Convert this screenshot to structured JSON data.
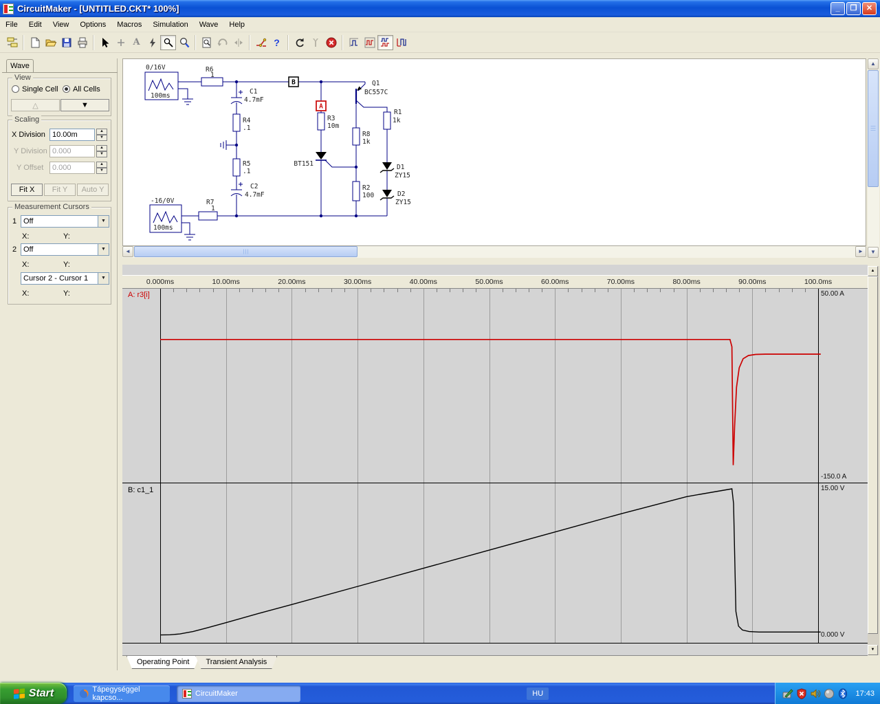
{
  "window": {
    "title": "CircuitMaker - [UNTITLED.CKT* 100%]"
  },
  "menu": {
    "items": [
      "File",
      "Edit",
      "View",
      "Options",
      "Macros",
      "Simulation",
      "Wave",
      "Help"
    ]
  },
  "wave_panel": {
    "tab_label": "Wave",
    "view": {
      "caption": "View",
      "single_cell": "Single Cell",
      "all_cells": "All Cells"
    },
    "scaling": {
      "caption": "Scaling",
      "x_division_label": "X Division",
      "x_division_value": "10.00m",
      "y_division_label": "Y Division",
      "y_division_value": "0.000",
      "y_offset_label": "Y Offset",
      "y_offset_value": "0.000",
      "fit_x": "Fit X",
      "fit_y": "Fit Y",
      "auto_y": "Auto Y"
    },
    "cursors": {
      "caption": "Measurement Cursors",
      "row1_num": "1",
      "row1_value": "Off",
      "row2_num": "2",
      "row2_value": "Off",
      "diff_value": "Cursor 2 - Cursor 1",
      "x_label": "X:",
      "y_label": "Y:"
    }
  },
  "schematic": {
    "src1_top": "0/16V",
    "src1_bottom": "100ms",
    "src2_top": "-16/0V",
    "src2_bottom": "100ms",
    "r6_name": "R6",
    "r6_value": "1",
    "c1_name": "C1",
    "c1_value": "4.7mF",
    "r4_name": "R4",
    "r4_value": ".1",
    "r5_name": "R5",
    "r5_value": ".1",
    "c2_name": "C2",
    "c2_value": "4.7mF",
    "r7_name": "R7",
    "r7_value": "1",
    "node_b": "B",
    "node_a": "A",
    "r3_name": "R3",
    "r3_value": "10m",
    "scr_name": "BT151",
    "r8_name": "R8",
    "r8_value": "1k",
    "r2_name": "R2",
    "r2_value": "100",
    "q1_name": "Q1",
    "q1_value": "BC557C",
    "r1_name": "R1",
    "r1_value": "1k",
    "d1_name": "D1",
    "d1_value": "ZY15",
    "d2_name": "D2",
    "d2_value": "ZY15"
  },
  "chart_data": [
    {
      "type": "line",
      "name": "A: r3[i]",
      "color": "#cc0000",
      "x_unit": "ms",
      "x_ticks": [
        "0.000ms",
        "10.00ms",
        "20.00ms",
        "30.00ms",
        "40.00ms",
        "50.00ms",
        "60.00ms",
        "70.00ms",
        "80.00ms",
        "90.00ms",
        "100.0ms"
      ],
      "xlim": [
        0,
        100
      ],
      "ylim": [
        -150,
        50
      ],
      "y_max_label": "50.00 A",
      "y_min_label": "-150.0 A",
      "points": [
        [
          0,
          0
        ],
        [
          86.6,
          0
        ],
        [
          86.9,
          -8
        ],
        [
          87.1,
          -137
        ],
        [
          87.3,
          -95
        ],
        [
          87.6,
          -52
        ],
        [
          88.0,
          -31
        ],
        [
          88.6,
          -21
        ],
        [
          89.4,
          -17.5
        ],
        [
          90.5,
          -16.3
        ],
        [
          92,
          -16
        ],
        [
          100.4,
          -16
        ]
      ]
    },
    {
      "type": "line",
      "name": "B: c1_1",
      "color": "#000000",
      "xlim": [
        0,
        100
      ],
      "ylim": [
        0,
        15
      ],
      "y_max_label": "15.00 V",
      "y_min_label": "0.000 V",
      "points": [
        [
          0,
          0.1
        ],
        [
          1.5,
          0.12
        ],
        [
          3,
          0.2
        ],
        [
          5,
          0.45
        ],
        [
          7,
          0.8
        ],
        [
          10,
          1.35
        ],
        [
          15,
          2.3
        ],
        [
          20,
          3.2
        ],
        [
          30,
          5.05
        ],
        [
          40,
          6.9
        ],
        [
          50,
          8.75
        ],
        [
          60,
          10.6
        ],
        [
          70,
          12.45
        ],
        [
          80,
          14.2
        ],
        [
          86.9,
          15.0
        ],
        [
          87.15,
          13.5
        ],
        [
          87.5,
          2.5
        ],
        [
          87.9,
          1.0
        ],
        [
          88.5,
          0.6
        ],
        [
          89.5,
          0.45
        ],
        [
          91,
          0.4
        ],
        [
          100.4,
          0.4
        ]
      ]
    }
  ],
  "bottom_tabs": {
    "tab1": "Operating Point",
    "tab2": "Transient Analysis"
  },
  "taskbar": {
    "start": "Start",
    "task1": "Tápegységgel kapcso...",
    "task2": "CircuitMaker",
    "lang": "HU",
    "clock": "17:43"
  }
}
